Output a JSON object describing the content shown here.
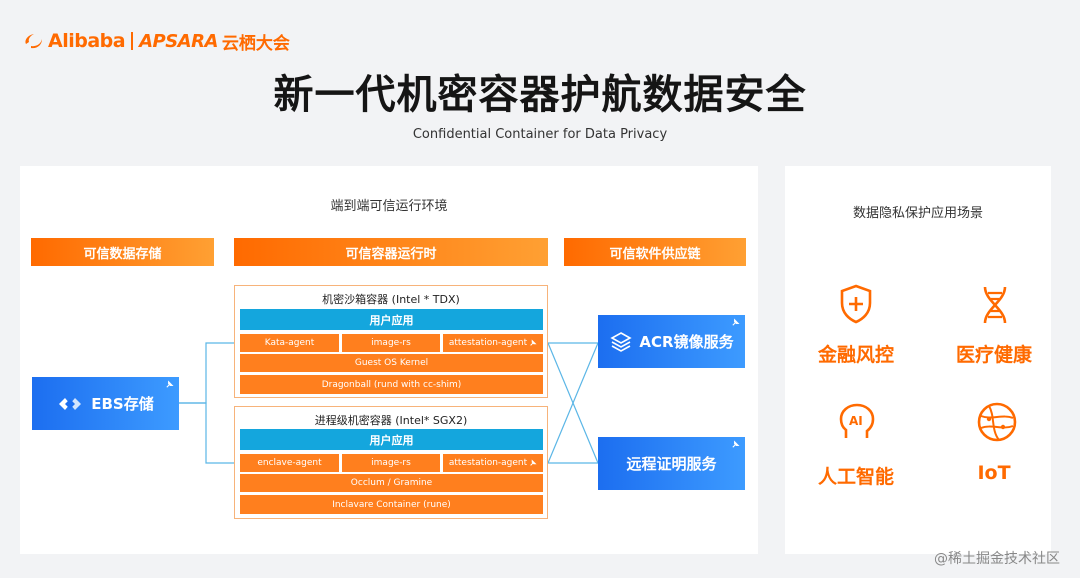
{
  "header": {
    "brand": "Alibaba",
    "sub_brand": "APSARA",
    "event_name": "云栖大会",
    "title": "新一代机密容器护航数据安全",
    "subtitle": "Confidential Container for Data Privacy"
  },
  "left_panel": {
    "title": "端到端可信运行环境",
    "columns": {
      "storage": "可信数据存储",
      "runtime": "可信容器运行时",
      "supply_chain": "可信软件供应链"
    },
    "storage_service": "EBS存储",
    "tdx_box": {
      "title": "机密沙箱容器 (Intel * TDX)",
      "app": "用户应用",
      "agents": [
        "Kata-agent",
        "image-rs",
        "attestation-agent"
      ],
      "kernel": "Guest OS Kernel",
      "vmm": "Dragonball (rund  with cc-shim)"
    },
    "sgx_box": {
      "title": "进程级机密容器 (Intel* SGX2)",
      "app": "用户应用",
      "agents": [
        "enclave-agent",
        "image-rs",
        "attestation-agent"
      ],
      "libos": "Occlum / Gramine",
      "runtime": "Inclavare Container (rune)"
    },
    "services": {
      "acr": "ACR镜像服务",
      "attestation": "远程证明服务"
    }
  },
  "right_panel": {
    "title": "数据隐私保护应用场景",
    "scenarios": [
      {
        "label": "金融风控",
        "icon": "shield-plus-icon"
      },
      {
        "label": "医疗健康",
        "icon": "dna-icon"
      },
      {
        "label": "人工智能",
        "icon": "ai-head-icon"
      },
      {
        "label": "IoT",
        "icon": "globe-network-icon"
      }
    ]
  },
  "watermark": "@稀土掘金技术社区",
  "colors": {
    "accent_orange": "#ff6a00",
    "service_blue": "#1c6ef0",
    "app_cyan": "#14a6dd",
    "bar_orange": "#ff7f1e",
    "connector_blue": "#5bb6e6"
  }
}
